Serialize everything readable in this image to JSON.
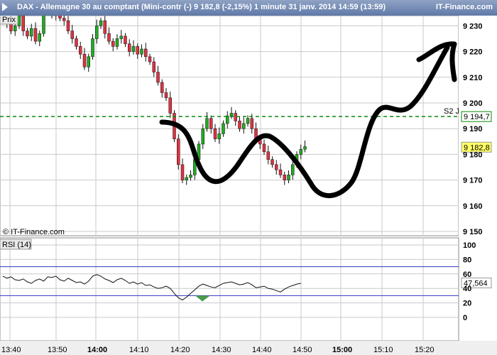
{
  "header": {
    "title": "DAX - Allemagne 30 au comptant (Mini-contr (-)    9 182,8 (-2,15%)    1 minute  31 janv. 2014 14:59 (13:59)",
    "brand": "IT-Finance.com"
  },
  "panel_labels": {
    "price": "Prix",
    "rsi": "RSI (14)",
    "copyright": "© IT-Finance.com"
  },
  "colors": {
    "up": "#22aa22",
    "down": "#dd3344",
    "grid": "#c9c9c9",
    "level": "#0a8a0a",
    "rsi_band": "#3333cc",
    "rsi_fill": "#4a9a4a",
    "panel": "#efefef"
  },
  "chart_data": [
    {
      "type": "candlestick",
      "title": "DAX - Allemagne 30 au comptant (Mini-contr (-)",
      "timeframe": "1 minute",
      "date": "31 janv. 2014",
      "last_price": "9 182,8",
      "change": "-2,15%",
      "ylim": [
        9150,
        9240
      ],
      "y_ticks": [
        "9 150",
        "9 160",
        "9 170",
        "9 180",
        "9 190",
        "9 200",
        "9 210",
        "9 220",
        "9 230"
      ],
      "x_ticks": [
        "13:40",
        "13:50",
        "14:00",
        "14:10",
        "14:20",
        "14:30",
        "14:40",
        "14:50",
        "15:00",
        "15:10",
        "15:20"
      ],
      "x_ticks_bold": [
        "14:00",
        "15:00"
      ],
      "x_range_minutes": [
        13.4,
        15.37
      ],
      "support_level": {
        "label": "S2 J",
        "value": 9194.7,
        "display": "9 194,7"
      },
      "last_display": "9 182,8",
      "series": [
        {
          "x": [
            [
              13.37,
              9234,
              9240,
              9231,
              9237
            ],
            [
              13.38,
              9237,
              9239,
              9229,
              9231
            ],
            [
              13.39,
              9231,
              9233,
              9226,
              9228
            ],
            [
              13.4,
              9228,
              9232,
              9226,
              9231
            ],
            [
              13.41,
              9231,
              9238,
              9229,
              9236
            ],
            [
              13.42,
              9236,
              9238,
              9225,
              9227
            ],
            [
              13.43,
              9227,
              9230,
              9224,
              9229
            ],
            [
              13.44,
              9229,
              9231,
              9222,
              9224
            ],
            [
              13.45,
              9224,
              9229,
              9223,
              9228
            ],
            [
              13.46,
              9228,
              9241,
              9227,
              9240
            ],
            [
              13.47,
              9240,
              9242,
              9233,
              9235
            ],
            [
              13.48,
              9235,
              9240,
              9233,
              9238
            ],
            [
              13.49,
              9238,
              9241,
              9232,
              9234
            ]
          ]
        }
      ]
    },
    {
      "type": "line",
      "title": "RSI (14)",
      "ylim": [
        0,
        100
      ],
      "y_ticks": [
        "0",
        "20",
        "40",
        "60",
        "80",
        "100"
      ],
      "bands": [
        30,
        70
      ],
      "last_display": "47,564"
    }
  ]
}
